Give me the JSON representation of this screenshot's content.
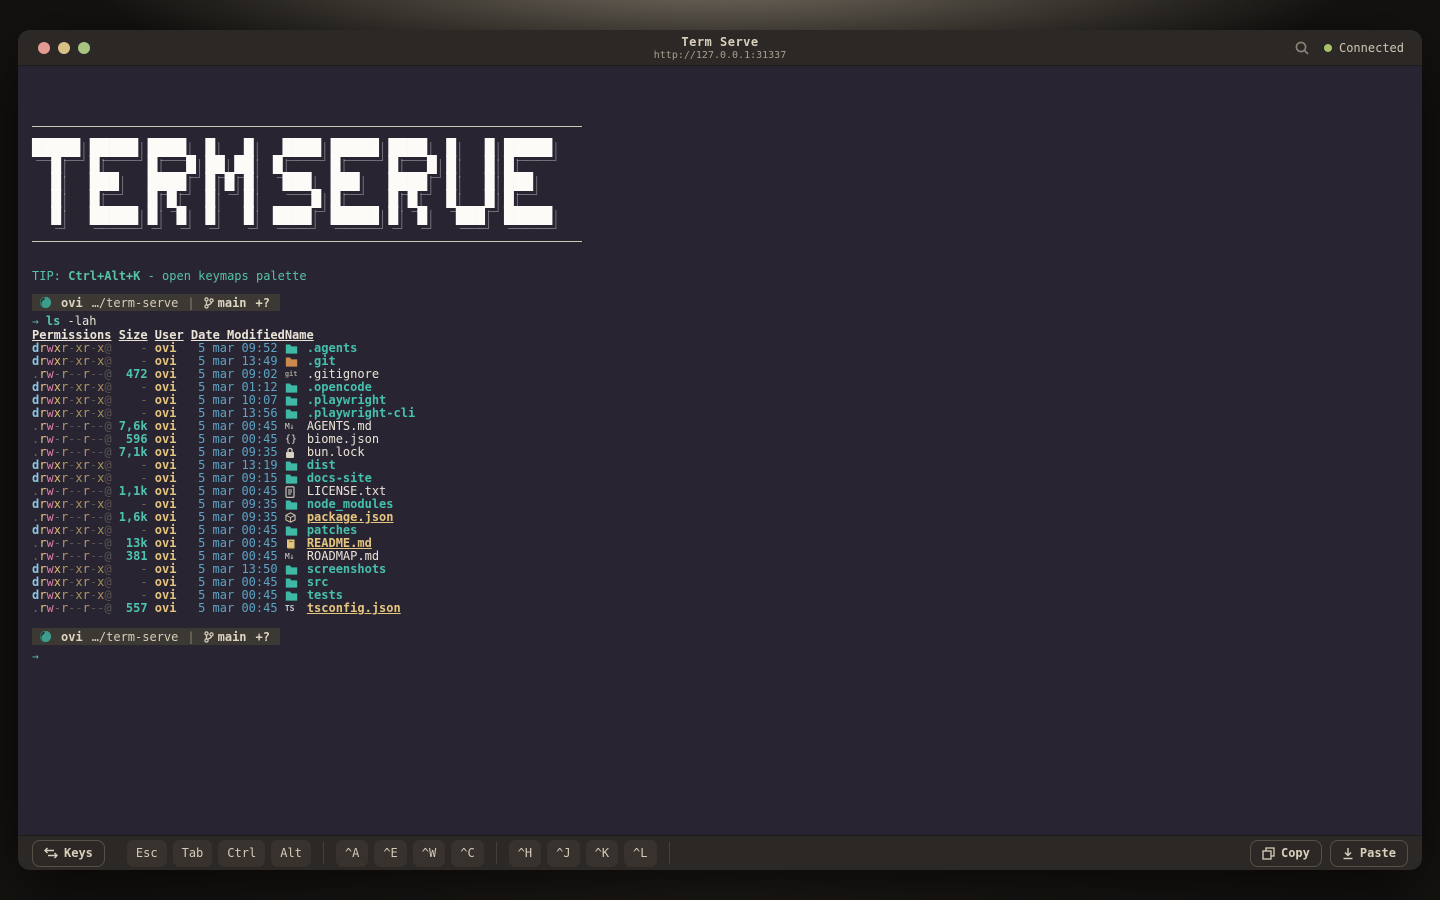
{
  "window": {
    "title": "Term Serve",
    "url": "http://127.0.0.1:31337",
    "status_label": "Connected"
  },
  "banner": {
    "lines": [
      "█████ █████ ████  █   █   ████ █████ ████  █   █ █████",
      "  █   █     █   █ ██ ██  █     █     █   █ █   █ █    ",
      "  █   ███   ████  █ █ █   ███  ███   ████  █   █ ███  ",
      "  █   █     █ █   █   █      █ █     █ █   █   █ █    ",
      "  █   █████ █  █  █   █  ████  █████ █  █   ███  █████"
    ]
  },
  "tip": {
    "prefix": "TIP: ",
    "keys": "Ctrl+Alt+K",
    "suffix": " - open keymaps palette"
  },
  "prompt": {
    "user": "ovi",
    "path": "…/term-serve",
    "separator": "|",
    "branch": "main",
    "git_status": "+?"
  },
  "command": {
    "arrow": "→",
    "name": "ls",
    "args": " -lah",
    "cursor": "→"
  },
  "ls": {
    "headers": [
      "Permissions",
      "Size",
      "User",
      "Date Modified",
      "Name"
    ],
    "rows": [
      {
        "perms": "drwxr-xr-x@",
        "size": "-",
        "user": "ovi",
        "date": "5 mar 09:52",
        "icon": "folder",
        "name": ".agents",
        "kind": "dir"
      },
      {
        "perms": "drwxr-xr-x@",
        "size": "-",
        "user": "ovi",
        "date": "5 mar 13:49",
        "icon": "git-folder",
        "name": ".git",
        "kind": "dir"
      },
      {
        "perms": ".rw-r--r--@",
        "size": "472",
        "user": "ovi",
        "date": "5 mar 09:02",
        "icon": "git",
        "name": ".gitignore",
        "kind": "file"
      },
      {
        "perms": "drwxr-xr-x@",
        "size": "-",
        "user": "ovi",
        "date": "5 mar 01:12",
        "icon": "folder",
        "name": ".opencode",
        "kind": "dir"
      },
      {
        "perms": "drwxr-xr-x@",
        "size": "-",
        "user": "ovi",
        "date": "5 mar 10:07",
        "icon": "folder",
        "name": ".playwright",
        "kind": "dir"
      },
      {
        "perms": "drwxr-xr-x@",
        "size": "-",
        "user": "ovi",
        "date": "5 mar 13:56",
        "icon": "folder",
        "name": ".playwright-cli",
        "kind": "dir"
      },
      {
        "perms": ".rw-r--r--@",
        "size": "7,6k",
        "user": "ovi",
        "date": "5 mar 00:45",
        "icon": "markdown",
        "name": "AGENTS.md",
        "kind": "file"
      },
      {
        "perms": ".rw-r--r--@",
        "size": "596",
        "user": "ovi",
        "date": "5 mar 00:45",
        "icon": "braces",
        "name": "biome.json",
        "kind": "file"
      },
      {
        "perms": ".rw-r--r--@",
        "size": "7,1k",
        "user": "ovi",
        "date": "5 mar 09:35",
        "icon": "lock",
        "name": "bun.lock",
        "kind": "file"
      },
      {
        "perms": "drwxr-xr-x@",
        "size": "-",
        "user": "ovi",
        "date": "5 mar 13:19",
        "icon": "folder",
        "name": "dist",
        "kind": "dir"
      },
      {
        "perms": "drwxr-xr-x@",
        "size": "-",
        "user": "ovi",
        "date": "5 mar 09:15",
        "icon": "folder",
        "name": "docs-site",
        "kind": "dir"
      },
      {
        "perms": ".rw-r--r--@",
        "size": "1,1k",
        "user": "ovi",
        "date": "5 mar 00:45",
        "icon": "doc",
        "name": "LICENSE.txt",
        "kind": "file"
      },
      {
        "perms": "drwxr-xr-x@",
        "size": "-",
        "user": "ovi",
        "date": "5 mar 09:35",
        "icon": "folder",
        "name": "node_modules",
        "kind": "dir"
      },
      {
        "perms": ".rw-r--r--@",
        "size": "1,6k",
        "user": "ovi",
        "date": "5 mar 09:35",
        "icon": "npm",
        "name": "package.json",
        "kind": "special"
      },
      {
        "perms": "drwxr-xr-x@",
        "size": "-",
        "user": "ovi",
        "date": "5 mar 00:45",
        "icon": "folder",
        "name": "patches",
        "kind": "dir"
      },
      {
        "perms": ".rw-r--r--@",
        "size": "13k",
        "user": "ovi",
        "date": "5 mar 00:45",
        "icon": "book",
        "name": "README.md",
        "kind": "special"
      },
      {
        "perms": ".rw-r--r--@",
        "size": "381",
        "user": "ovi",
        "date": "5 mar 00:45",
        "icon": "markdown",
        "name": "ROADMAP.md",
        "kind": "file"
      },
      {
        "perms": "drwxr-xr-x@",
        "size": "-",
        "user": "ovi",
        "date": "5 mar 13:50",
        "icon": "folder",
        "name": "screenshots",
        "kind": "dir"
      },
      {
        "perms": "drwxr-xr-x@",
        "size": "-",
        "user": "ovi",
        "date": "5 mar 00:45",
        "icon": "folder",
        "name": "src",
        "kind": "dir"
      },
      {
        "perms": "drwxr-xr-x@",
        "size": "-",
        "user": "ovi",
        "date": "5 mar 00:45",
        "icon": "folder",
        "name": "tests",
        "kind": "dir"
      },
      {
        "perms": ".rw-r--r--@",
        "size": "557",
        "user": "ovi",
        "date": "5 mar 00:45",
        "icon": "ts",
        "name": "tsconfig.json",
        "kind": "special"
      }
    ]
  },
  "toolbar": {
    "keys_label": "Keys",
    "modifier_keys": [
      "Esc",
      "Tab",
      "Ctrl",
      "Alt"
    ],
    "ctrl_group_1": [
      "^A",
      "^E",
      "^W",
      "^C"
    ],
    "ctrl_group_2": [
      "^H",
      "^J",
      "^K",
      "^L"
    ],
    "copy_label": "Copy",
    "paste_label": "Paste"
  },
  "colors": {
    "terminal_bg": "#292432",
    "chrome_bg": "#2b2825",
    "teal": "#45c0ad",
    "yellow": "#e4c57e",
    "pink": "#df7fa8",
    "date_blue": "#5ba4c4",
    "perm_d_blue": "#8cc6e0",
    "connected_green": "#a8c06a",
    "cream": "#d9d0bc",
    "folder_icon": "#3fb8a5",
    "git_folder_icon": "#c98a4b"
  }
}
